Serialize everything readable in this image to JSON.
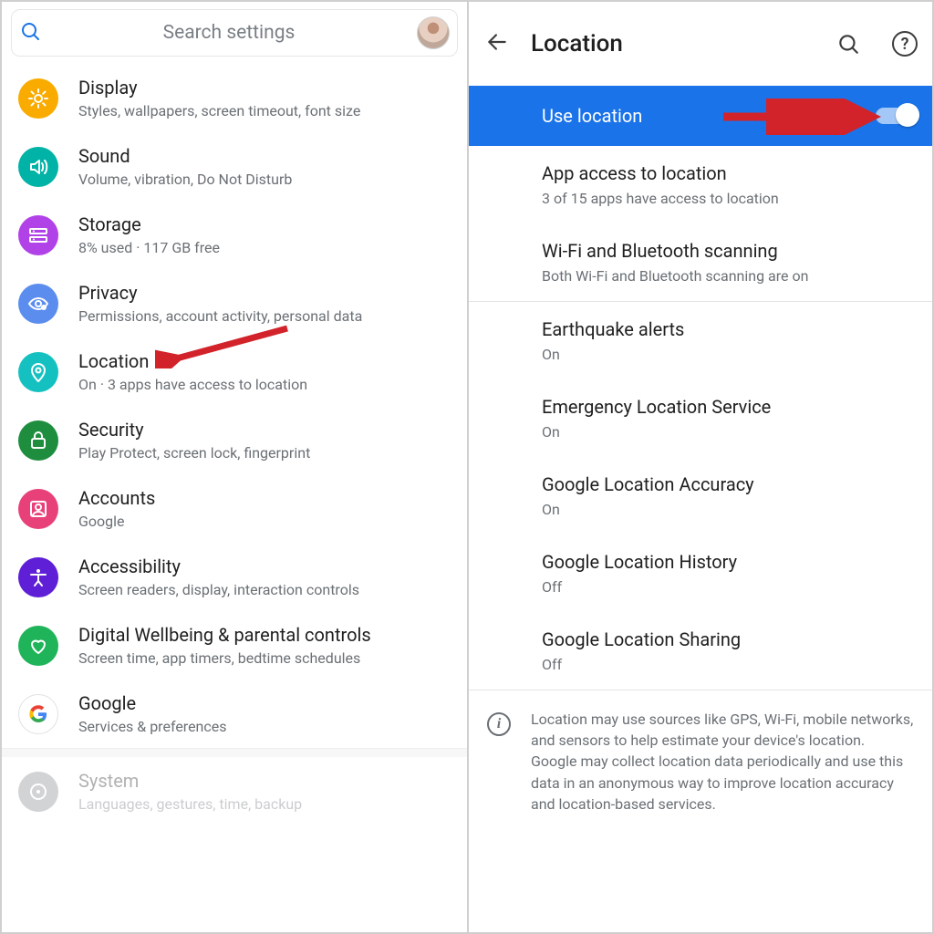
{
  "left": {
    "search_placeholder": "Search settings",
    "items": [
      {
        "key": "display",
        "title": "Display",
        "sub": "Styles, wallpapers, screen timeout, font size",
        "color": "#f9ab00"
      },
      {
        "key": "sound",
        "title": "Sound",
        "sub": "Volume, vibration, Do Not Disturb",
        "color": "#00b3a6"
      },
      {
        "key": "storage",
        "title": "Storage",
        "sub": "8% used · 117 GB free",
        "color": "#b142e8"
      },
      {
        "key": "privacy",
        "title": "Privacy",
        "sub": "Permissions, account activity, personal data",
        "color": "#5b8def"
      },
      {
        "key": "location",
        "title": "Location",
        "sub": "On · 3 apps have access to location",
        "color": "#15c1c0"
      },
      {
        "key": "security",
        "title": "Security",
        "sub": "Play Protect, screen lock, fingerprint",
        "color": "#1e8e3e"
      },
      {
        "key": "accounts",
        "title": "Accounts",
        "sub": "Google",
        "color": "#e8417a"
      },
      {
        "key": "accessibility",
        "title": "Accessibility",
        "sub": "Screen readers, display, interaction controls",
        "color": "#5e1fd6"
      },
      {
        "key": "wellbeing",
        "title": "Digital Wellbeing & parental controls",
        "sub": "Screen time, app timers, bedtime schedules",
        "color": "#1fb45a"
      },
      {
        "key": "google",
        "title": "Google",
        "sub": "Services & preferences",
        "color": "#ffffff"
      },
      {
        "key": "system",
        "title": "System",
        "sub": "Languages, gestures, time, backup",
        "color": "#808489"
      }
    ]
  },
  "right": {
    "page_title": "Location",
    "use_location_label": "Use location",
    "use_location_on": true,
    "rows": [
      {
        "t": "App access to location",
        "s": "3 of 15 apps have access to location"
      },
      {
        "t": "Wi-Fi and Bluetooth scanning",
        "s": "Both Wi-Fi and Bluetooth scanning are on"
      },
      {
        "t": "Earthquake alerts",
        "s": "On"
      },
      {
        "t": "Emergency Location Service",
        "s": "On"
      },
      {
        "t": "Google Location Accuracy",
        "s": "On"
      },
      {
        "t": "Google Location History",
        "s": "Off"
      },
      {
        "t": "Google Location Sharing",
        "s": "Off"
      }
    ],
    "info": "Location may use sources like GPS, Wi-Fi, mobile networks, and sensors to help estimate your device's location. Google may collect location data periodically and use this data in an anonymous way to improve location accuracy and location-based services."
  }
}
